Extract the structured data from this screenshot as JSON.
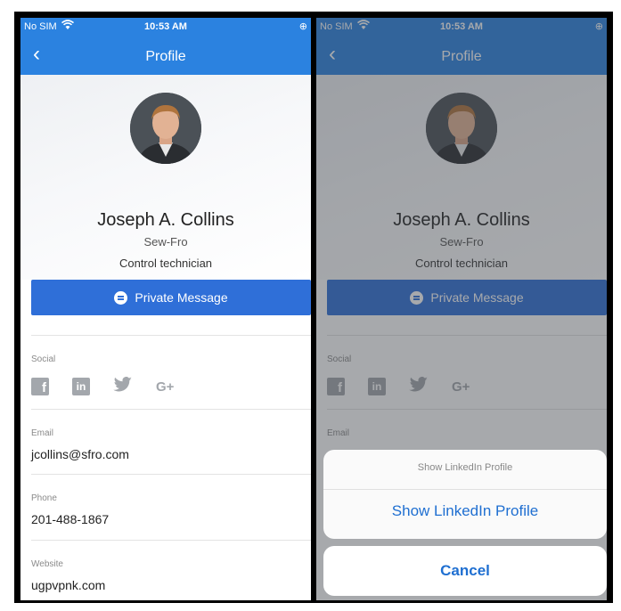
{
  "status_bar": {
    "carrier": "No SIM",
    "time": "10:53 AM"
  },
  "navbar": {
    "back_glyph": "‹",
    "title": "Profile"
  },
  "profile": {
    "name": "Joseph A. Collins",
    "company": "Sew-Fro",
    "role": "Control technician"
  },
  "actions": {
    "private_message": "Private Message"
  },
  "social": {
    "label": "Social",
    "icons": [
      "facebook-icon",
      "linkedin-icon",
      "twitter-icon",
      "google-plus-icon"
    ],
    "gplus_text": "G+"
  },
  "contact": {
    "email_label": "Email",
    "email": "jcollins@sfro.com",
    "phone_label": "Phone",
    "phone": "201-488-1867",
    "website_label": "Website",
    "website": "ugpvpnk.com"
  },
  "action_sheet": {
    "title": "Show LinkedIn Profile",
    "action": "Show LinkedIn Profile",
    "cancel": "Cancel"
  },
  "colors": {
    "brand_blue": "#2b82e0",
    "button_blue": "#2f6fd8",
    "link_blue": "#1f6fd1"
  }
}
